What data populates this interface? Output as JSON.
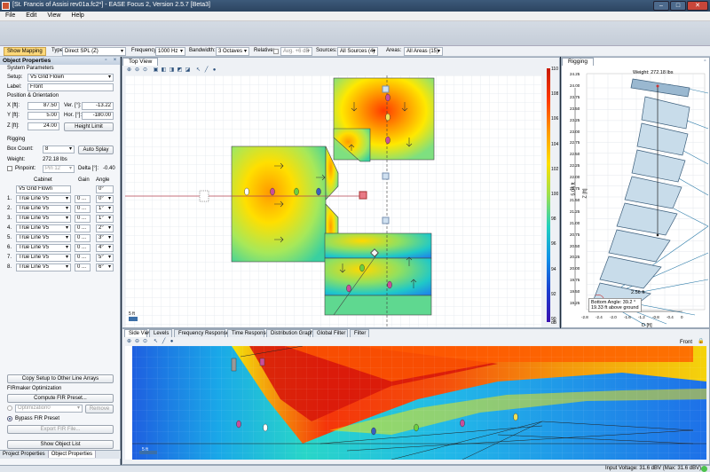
{
  "window": {
    "title": "[St. Francis of Assisi rev01a.fc2*] - EASE Focus 2, Version 2.5.7 [Beta3]",
    "minimize": "–",
    "maximize": "□",
    "close": "✕"
  },
  "menu": [
    "File",
    "Edit",
    "View",
    "Help"
  ],
  "toolbar": {
    "show_mapping": "Show Mapping",
    "type_label": "Type:",
    "type_value": "Direct SPL (Z)",
    "frequency_label": "Frequency:",
    "frequency_value": "1000 Hz",
    "bandwidth_label": "Bandwidth:",
    "bandwidth_value": "3 Octaves",
    "relative_label": "Relative:",
    "relative_value": "Avg. +6 dB",
    "sources_label": "Sources:",
    "sources_value": "All Sources (4)",
    "areas_label": "Areas:",
    "areas_value": "All Areas (15)"
  },
  "object_properties": {
    "header": "Object Properties",
    "system_params": "System Parameters",
    "setup_label": "Setup:",
    "setup_value": "V5 Grid Flown",
    "label_label": "Label:",
    "label_value": "Front",
    "pos_header": "Position & Orientation",
    "x_label": "X [ft]:",
    "x_value": "87.50",
    "vert_label": "Ver. [°]:",
    "vert_value": "-13.22",
    "y_label": "Y [ft]:",
    "y_value": "5.00",
    "hor_label": "Hor. [°]:",
    "hor_value": "-180.00",
    "z_label": "Z [ft]:",
    "z_value": "24.00",
    "height_limit": "Height Limit",
    "rigging_header": "Rigging",
    "box_count_label": "Box Count:",
    "box_count_value": "8",
    "auto_splay": "Auto Splay",
    "weight_label": "Weight:",
    "weight_value": "272.18 lbs",
    "pinpoint_label": "Pinpoint:",
    "pinpoint_value": "Pin 12",
    "delta_label": "Delta [°]:",
    "delta_value": "-0.40",
    "cab_header": "Cabinet",
    "gain_header": "Gain",
    "angle_header": "Angle",
    "cab_top": "V5 Grid Flown",
    "angle_top": "0°",
    "cabinets": [
      {
        "num": "1.",
        "name": "True Line V5",
        "gain": "0 ...",
        "angle": "0°"
      },
      {
        "num": "2.",
        "name": "True Line V5",
        "gain": "0 ...",
        "angle": "1°"
      },
      {
        "num": "3.",
        "name": "True Line V5",
        "gain": "0 ...",
        "angle": "1°"
      },
      {
        "num": "4.",
        "name": "True Line V5",
        "gain": "0 ...",
        "angle": "2°"
      },
      {
        "num": "5.",
        "name": "True Line V5",
        "gain": "0 ...",
        "angle": "3°"
      },
      {
        "num": "6.",
        "name": "True Line V5",
        "gain": "0 ...",
        "angle": "4°"
      },
      {
        "num": "7.",
        "name": "True Line V5",
        "gain": "0 ...",
        "angle": "5°"
      },
      {
        "num": "8.",
        "name": "True Line V5",
        "gain": "0 ...",
        "angle": "6°"
      }
    ],
    "copy_setup": "Copy Setup to Other Line Arrays",
    "fir_header": "FIRmaker Optimization",
    "compute_fir": "Compute FIR Preset...",
    "optimization_value": "Optimization0",
    "remove": "Remove",
    "bypass_label": "Bypass FIR Preset",
    "export_fir": "Export FIR File...",
    "show_object_list": "Show Object List"
  },
  "bottom_tabs": [
    "Project Properties",
    "Object Properties"
  ],
  "top_view": {
    "tab": "Top View",
    "scale": "5 ft",
    "dB_unit": "dB",
    "legend_ticks": [
      "110",
      "108",
      "106",
      "104",
      "102",
      "100",
      "98",
      "96",
      "94",
      "92",
      "90"
    ]
  },
  "rigging": {
    "tab": "Rigging",
    "weight": "Weight: 272.18 lbs",
    "bottom_angle": "Bottom Angle: 39.2 °",
    "above_ground": "19.33 ft above ground",
    "dim": "2.56 ft",
    "z_label": "Z [ft]",
    "d_label": "D [ft]",
    "dim_left": "5.04 ft",
    "y_ticks": [
      "24.25",
      "24.00",
      "23.75",
      "23.50",
      "23.25",
      "23.00",
      "22.75",
      "22.50",
      "22.25",
      "22.00",
      "21.75",
      "21.50",
      "21.25",
      "21.00",
      "20.75",
      "20.50",
      "20.25",
      "20.00",
      "19.75",
      "19.50",
      "19.25"
    ],
    "x_ticks": [
      "-2.8",
      "-2.4",
      "-2.0",
      "-1.6",
      "-1.2",
      "-0.8",
      "-0.4",
      "0"
    ]
  },
  "bottom_view": {
    "tabs": [
      "Side View",
      "Levels",
      "Frequency Response",
      "Time Response",
      "Distribution Graph",
      "Global Filter",
      "Filter"
    ],
    "front_label": "Front",
    "scale": "5 ft"
  },
  "status": {
    "voltage": "Input Voltage: 31.6 dBV (Max: 31.6 dBV)"
  }
}
